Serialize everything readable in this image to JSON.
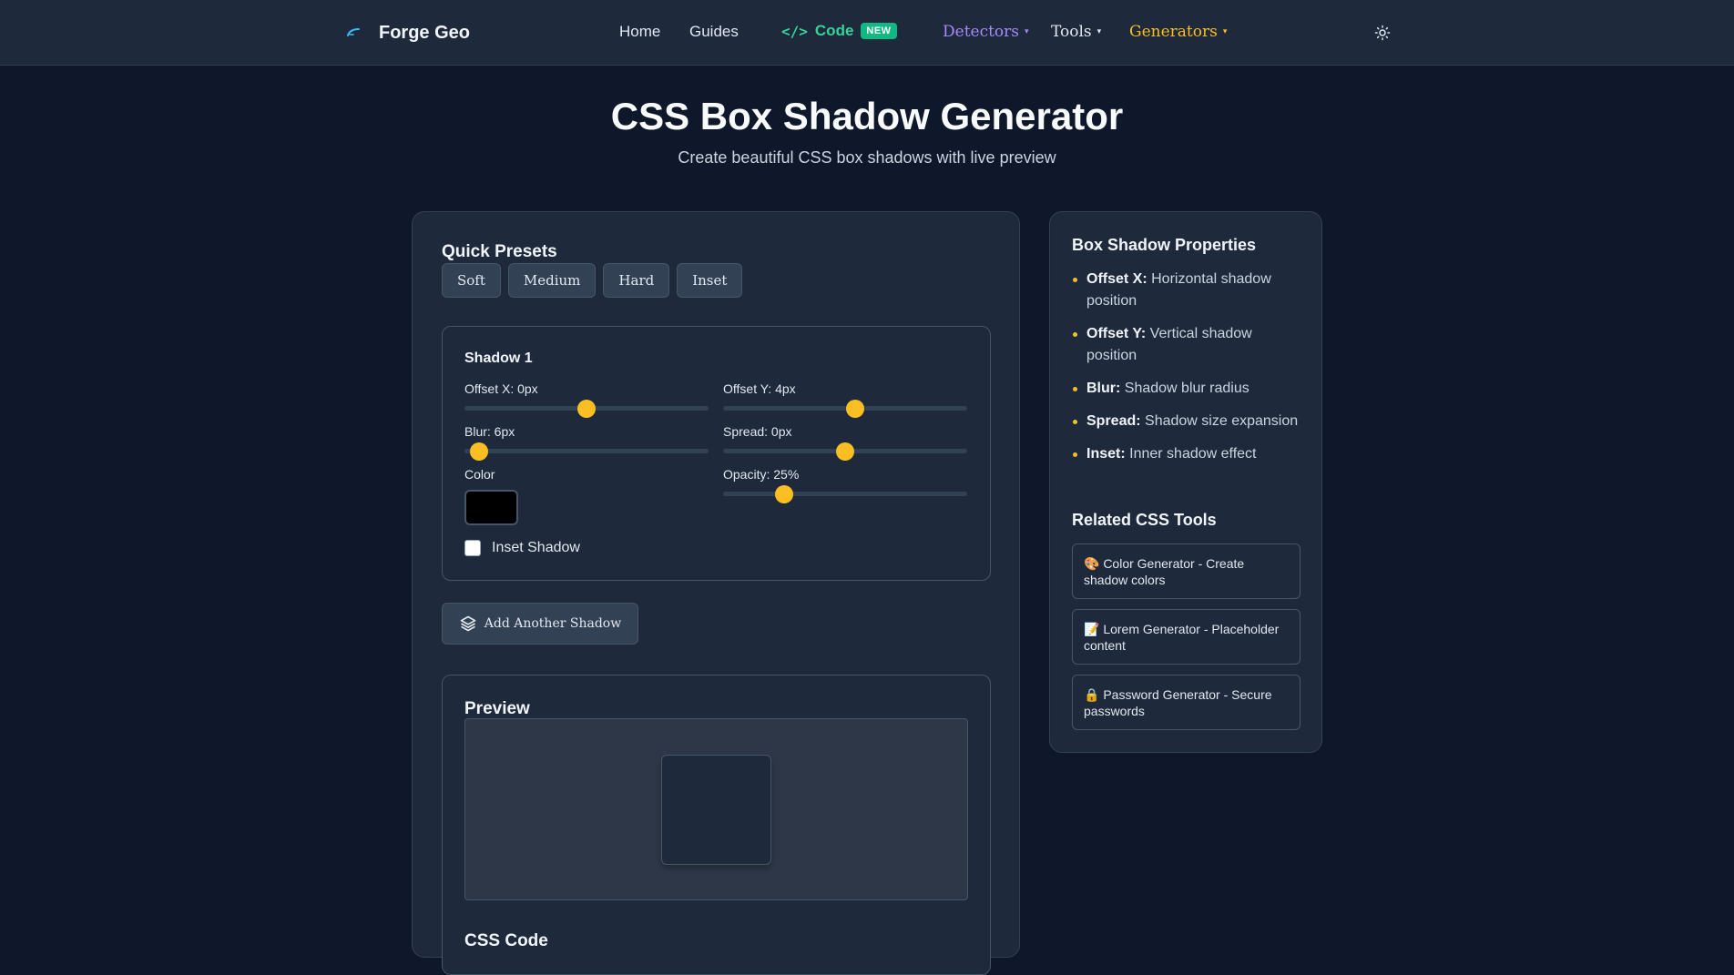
{
  "nav": {
    "brand": "Forge Geo",
    "links": {
      "home": "Home",
      "guides": "Guides"
    },
    "code": {
      "symbol": "</>",
      "label": "Code",
      "badge": "NEW"
    },
    "detectors": "Detectors",
    "tools": "Tools",
    "generators": "Generators",
    "caret": "▾"
  },
  "header": {
    "title": "CSS Box Shadow Generator",
    "subtitle": "Create beautiful CSS box shadows with live preview"
  },
  "presets": {
    "title": "Quick Presets",
    "items": [
      "Soft",
      "Medium",
      "Hard",
      "Inset"
    ]
  },
  "shadow": {
    "title": "Shadow 1",
    "offset_x": {
      "label": "Offset X: 0px",
      "value": 0,
      "min": -50,
      "max": 50
    },
    "offset_y": {
      "label": "Offset Y: 4px",
      "value": 4,
      "min": -50,
      "max": 50
    },
    "blur": {
      "label": "Blur: 6px",
      "value": 6,
      "min": 0,
      "max": 100
    },
    "spread": {
      "label": "Spread: 0px",
      "value": 0,
      "min": -50,
      "max": 50
    },
    "color_label": "Color",
    "color_value": "#000000",
    "opacity": {
      "label": "Opacity: 25%",
      "value": 25,
      "min": 0,
      "max": 100
    },
    "inset_label": "Inset Shadow",
    "inset_checked": false
  },
  "add_shadow": {
    "label": "Add Another Shadow"
  },
  "preview": {
    "title": "Preview"
  },
  "css_code": {
    "title": "CSS Code"
  },
  "side": {
    "properties_title": "Box Shadow Properties",
    "properties": [
      {
        "name": "Offset X:",
        "desc": "Horizontal shadow position"
      },
      {
        "name": "Offset Y:",
        "desc": "Vertical shadow position"
      },
      {
        "name": "Blur:",
        "desc": "Shadow blur radius"
      },
      {
        "name": "Spread:",
        "desc": "Shadow size expansion"
      },
      {
        "name": "Inset:",
        "desc": "Inner shadow effect"
      }
    ],
    "related_title": "Related CSS Tools",
    "related": [
      "🎨 Color Generator - Create shadow colors",
      "📝 Lorem Generator - Placeholder content",
      "🔒 Password Generator - Secure passwords"
    ]
  },
  "colors": {
    "accent": "#fbbf24",
    "code_green": "#34d399",
    "detectors": "#a78bfa",
    "generators": "#fbbf24",
    "background": "#0f172a",
    "panel": "#1e293b"
  }
}
